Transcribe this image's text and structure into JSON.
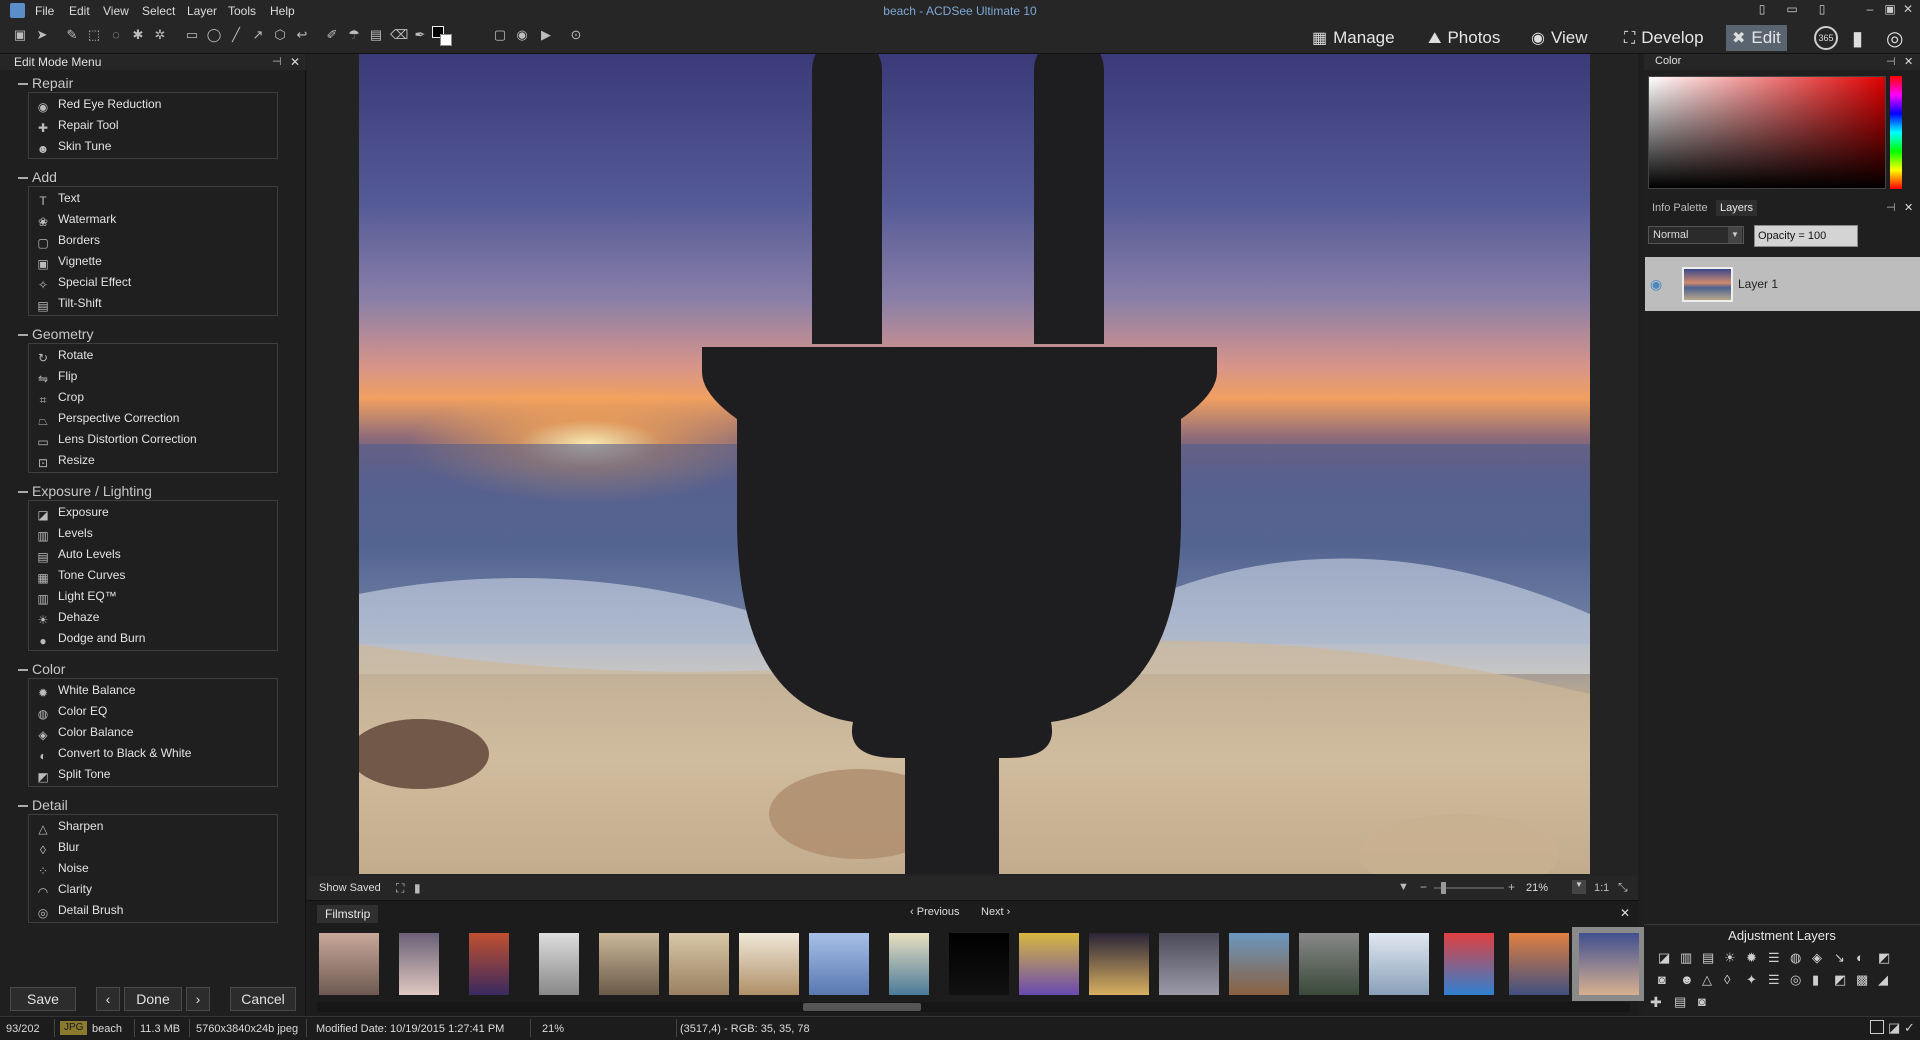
{
  "window": {
    "title": "beach - ACDSee Ultimate 10",
    "menu": [
      "File",
      "Edit",
      "View",
      "Select",
      "Layer",
      "Tools",
      "Help"
    ]
  },
  "modes": [
    {
      "label": "Manage",
      "icon": "grid-icon"
    },
    {
      "label": "Photos",
      "icon": "photos-icon"
    },
    {
      "label": "View",
      "icon": "eye-icon"
    },
    {
      "label": "Develop",
      "icon": "develop-icon"
    },
    {
      "label": "Edit",
      "icon": "edit-icon",
      "active": true
    }
  ],
  "left_panel": {
    "title": "Edit Mode Menu",
    "groups": [
      {
        "title": "Repair",
        "items": [
          "Red Eye Reduction",
          "Repair Tool",
          "Skin Tune"
        ]
      },
      {
        "title": "Add",
        "items": [
          "Text",
          "Watermark",
          "Borders",
          "Vignette",
          "Special Effect",
          "Tilt-Shift"
        ]
      },
      {
        "title": "Geometry",
        "items": [
          "Rotate",
          "Flip",
          "Crop",
          "Perspective Correction",
          "Lens Distortion Correction",
          "Resize"
        ]
      },
      {
        "title": "Exposure / Lighting",
        "items": [
          "Exposure",
          "Levels",
          "Auto Levels",
          "Tone Curves",
          "Light EQ™",
          "Dehaze",
          "Dodge and Burn"
        ]
      },
      {
        "title": "Color",
        "items": [
          "White Balance",
          "Color EQ",
          "Color Balance",
          "Convert to Black & White",
          "Split Tone"
        ]
      },
      {
        "title": "Detail",
        "items": [
          "Sharpen",
          "Blur",
          "Noise",
          "Clarity",
          "Detail Brush"
        ]
      }
    ],
    "buttons": {
      "save": "Save",
      "done": "Done",
      "cancel": "Cancel"
    }
  },
  "canvas_bar": {
    "show_saved": "Show Saved",
    "zoom": "21%",
    "ratio": "1:1"
  },
  "filmstrip": {
    "tab": "Filmstrip",
    "previous": "Previous",
    "next": "Next",
    "thumb_count": 19,
    "selected_index": 18
  },
  "right_panel": {
    "color_title": "Color",
    "tabs": [
      "Info Palette",
      "Layers"
    ],
    "active_tab": "Layers",
    "blend_mode": "Normal",
    "opacity": "Opacity = 100",
    "layer_name": "Layer 1",
    "adjustment_title": "Adjustment Layers"
  },
  "status": {
    "index": "93/202",
    "format": "JPG",
    "filename": "beach",
    "size": "11.3 MB",
    "dimensions": "5760x3840x24b jpeg",
    "modified": "Modified Date: 10/19/2015 1:27:41 PM",
    "zoom": "21%",
    "pixel_info": "(3517,4) - RGB: 35, 35, 78"
  },
  "colors": {
    "accent": "#7fa7d6",
    "plug": "#1e1e20",
    "panel": "#1f1f1f"
  }
}
